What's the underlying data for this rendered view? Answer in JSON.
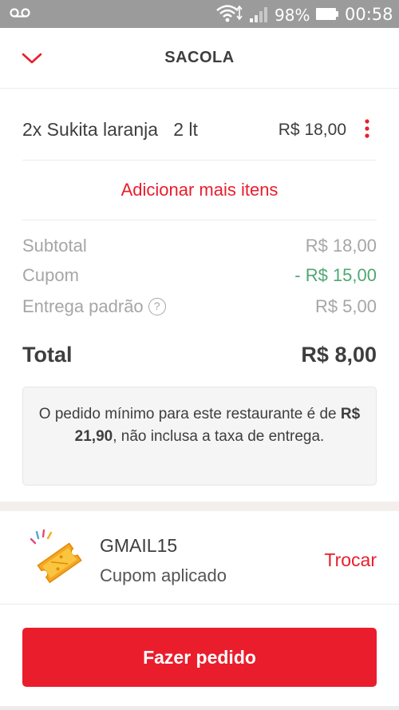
{
  "status_bar": {
    "battery_percent": "98%",
    "time": "00:58",
    "icons": [
      "voicemail-icon",
      "wifi-icon",
      "signal-icon",
      "battery-icon"
    ]
  },
  "header": {
    "title": "SACOLA",
    "back_icon": "chevron-down-icon"
  },
  "cart": {
    "items": [
      {
        "name": "2x Sukita laranja   2 lt",
        "price": "R$ 18,00"
      }
    ],
    "add_more_label": "Adicionar mais itens"
  },
  "summary": {
    "subtotal_label": "Subtotal",
    "subtotal_value": "R$ 18,00",
    "coupon_label": "Cupom",
    "coupon_value": "- R$ 15,00",
    "delivery_label": "Entrega padrão",
    "delivery_help": "?",
    "delivery_value": "R$ 5,00",
    "total_label": "Total",
    "total_value": "R$ 8,00"
  },
  "notice": {
    "text_before": "O pedido mínimo para este restaurante é de ",
    "amount": "R$ 21,90",
    "text_after": ", não inclusa a taxa de entrega."
  },
  "coupon": {
    "code": "GMAIL15",
    "status": "Cupom aplicado",
    "change_label": "Trocar",
    "icon": "ticket-icon"
  },
  "checkout": {
    "button_label": "Fazer pedido"
  },
  "colors": {
    "accent": "#ea1d2c",
    "discount": "#50a773",
    "status_bar": "#9b9b9b"
  }
}
